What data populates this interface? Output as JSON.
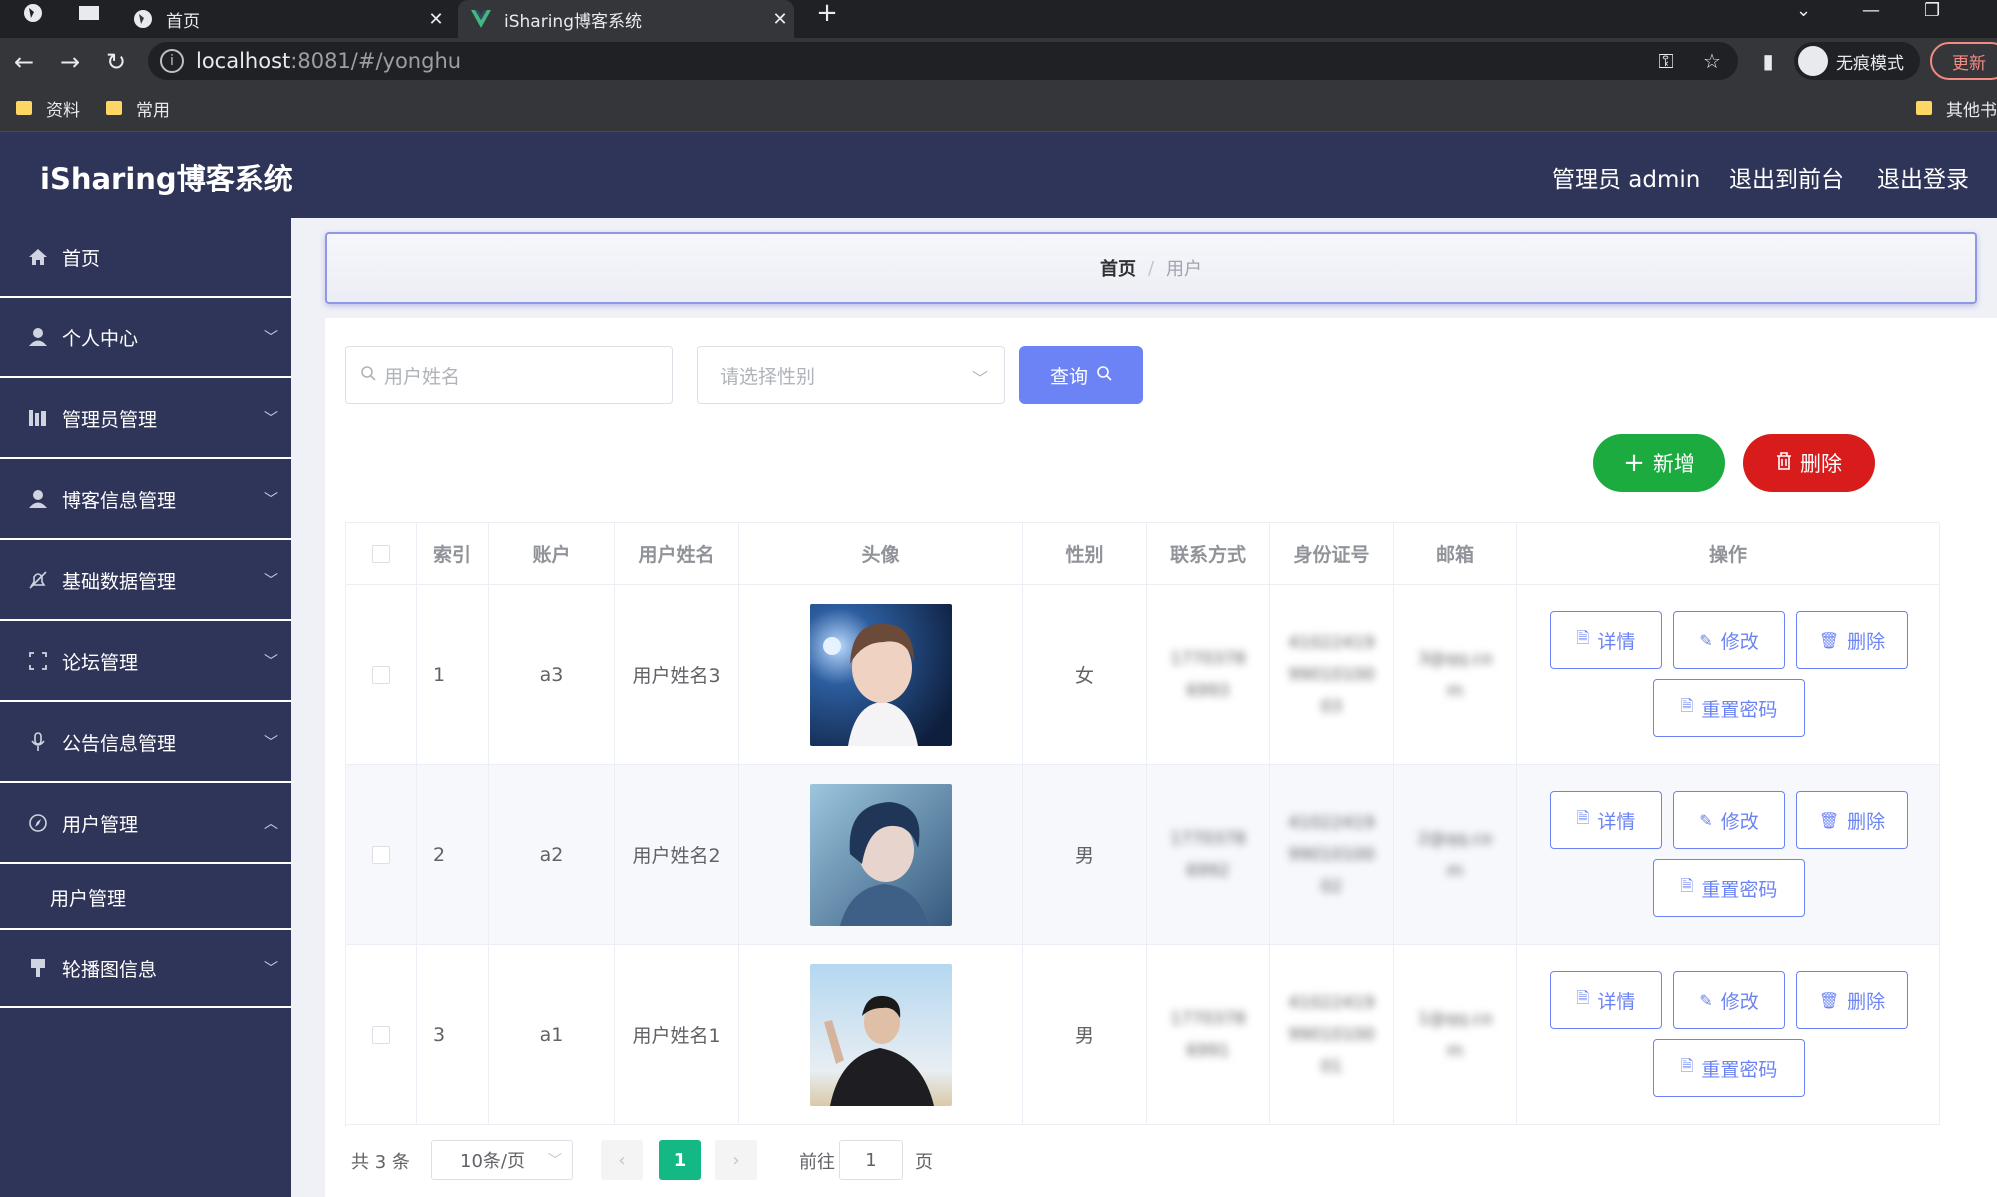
{
  "browser": {
    "tabs": [
      {
        "title": "首页",
        "active": false
      },
      {
        "title": "iSharing博客系统",
        "active": true
      }
    ],
    "url_host": "localhost",
    "url_path": ":8081/#/yonghu",
    "incognito_label": "无痕模式",
    "update_label": "更新",
    "bookmarks": [
      "资料",
      "常用"
    ],
    "other_bookmarks": "其他书"
  },
  "app": {
    "title": "iSharing博客系统",
    "header_links": [
      "管理员 admin",
      "退出到前台",
      "退出登录"
    ]
  },
  "sidebar": {
    "items": [
      {
        "label": "首页",
        "icon": "home-icon",
        "expandable": false
      },
      {
        "label": "个人中心",
        "icon": "user-icon",
        "expandable": true
      },
      {
        "label": "管理员管理",
        "icon": "bars-icon",
        "expandable": true
      },
      {
        "label": "博客信息管理",
        "icon": "user-icon",
        "expandable": true
      },
      {
        "label": "基础数据管理",
        "icon": "bell-off-icon",
        "expandable": true
      },
      {
        "label": "论坛管理",
        "icon": "frame-icon",
        "expandable": true
      },
      {
        "label": "公告信息管理",
        "icon": "mic-icon",
        "expandable": true
      },
      {
        "label": "用户管理",
        "icon": "compass-icon",
        "expandable": true,
        "expanded": true
      },
      {
        "label": "轮播图信息",
        "icon": "flag-icon",
        "expandable": true
      }
    ],
    "submenu": [
      "用户管理"
    ]
  },
  "breadcrumb": {
    "home": "首页",
    "separator": "/",
    "current": "用户"
  },
  "filters": {
    "name_placeholder": "用户姓名",
    "gender_placeholder": "请选择性别",
    "query_label": "查询"
  },
  "actions": {
    "add_label": "新增",
    "delete_label": "删除"
  },
  "table": {
    "columns": [
      "索引",
      "账户",
      "用户姓名",
      "头像",
      "性别",
      "联系方式",
      "身份证号",
      "邮箱",
      "操作"
    ],
    "rows": [
      {
        "index": "1",
        "account": "a3",
        "name": "用户姓名3",
        "gender": "女",
        "phone": "17703786993",
        "id_card": "410224199901010003",
        "email": "3@qq.com"
      },
      {
        "index": "2",
        "account": "a2",
        "name": "用户姓名2",
        "gender": "男",
        "phone": "17703786992",
        "id_card": "410224199901010002",
        "email": "2@qq.com"
      },
      {
        "index": "3",
        "account": "a1",
        "name": "用户姓名1",
        "gender": "男",
        "phone": "17703786991",
        "id_card": "410224199901010001",
        "email": "1@qq.com"
      }
    ],
    "row_actions": {
      "detail": "详情",
      "edit": "修改",
      "delete": "删除",
      "reset": "重置密码"
    }
  },
  "pagination": {
    "total": "共 3 条",
    "page_size": "10条/页",
    "current_page": "1",
    "goto_label": "前往",
    "goto_value": "1",
    "page_unit": "页"
  },
  "colors": {
    "sidebar_bg": "#2f3558",
    "primary": "#6b83f5",
    "success": "#1bab3f",
    "danger": "#d81b1b",
    "page_active": "#13b884"
  }
}
